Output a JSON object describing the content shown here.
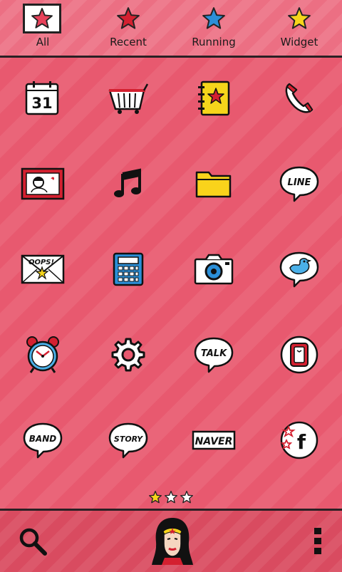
{
  "tabs": [
    {
      "label": "All",
      "star_color": "#e8415a",
      "active": true
    },
    {
      "label": "Recent",
      "star_color": "#d42030",
      "active": false
    },
    {
      "label": "Running",
      "star_color": "#2b8fd8",
      "active": false
    },
    {
      "label": "Widget",
      "star_color": "#f6d51b",
      "active": false
    }
  ],
  "apps": {
    "calendar": {
      "day": "31"
    },
    "line": {
      "text": "LINE"
    },
    "oops": {
      "text": "OOPS!"
    },
    "talk": {
      "text": "TALK"
    },
    "band": {
      "text": "BAND"
    },
    "story": {
      "text": "STORY"
    },
    "naver": {
      "text": "NAVER"
    },
    "facebook": {
      "letter": "f"
    }
  },
  "pager": {
    "pages": 3,
    "current": 1
  },
  "colors": {
    "accent_red": "#d42030",
    "star_yellow": "#f6d51b",
    "star_blue": "#2b8fd8",
    "folder_yellow": "#f9d31b",
    "background": "#e8596f"
  }
}
